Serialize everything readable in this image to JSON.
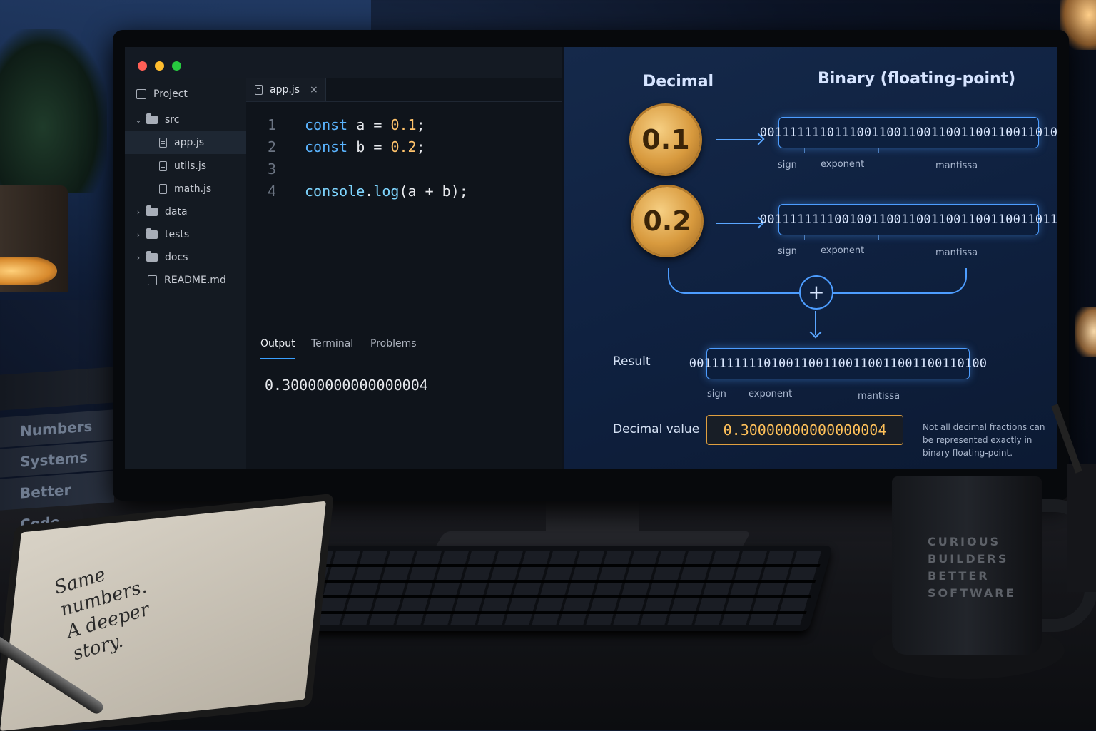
{
  "editor": {
    "sidebar": {
      "project_label": "Project",
      "items": [
        {
          "label": "src",
          "type": "folder",
          "expanded": true
        },
        {
          "label": "app.js",
          "type": "file",
          "active": true
        },
        {
          "label": "utils.js",
          "type": "file"
        },
        {
          "label": "math.js",
          "type": "file"
        },
        {
          "label": "data",
          "type": "folder"
        },
        {
          "label": "tests",
          "type": "folder"
        },
        {
          "label": "docs",
          "type": "folder"
        },
        {
          "label": "README.md",
          "type": "file"
        }
      ]
    },
    "tab": {
      "label": "app.js",
      "close": "×"
    },
    "code": {
      "line_numbers": [
        "1",
        "2",
        "3",
        "4"
      ],
      "lines": [
        {
          "kw": "const",
          "name": " a = ",
          "num": "0.1",
          "end": ";"
        },
        {
          "kw": "const",
          "name": " b = ",
          "num": "0.2",
          "end": ";"
        },
        {
          "text": ""
        },
        {
          "fn_obj": "console",
          "dot": ".",
          "fn": "log",
          "rest": "(a + b);"
        }
      ]
    },
    "panel": {
      "tabs": [
        "Output",
        "Terminal",
        "Problems"
      ],
      "active_tab": "Output",
      "output": "0.30000000000000004"
    }
  },
  "diagram": {
    "headers": {
      "decimal": "Decimal",
      "binary": "Binary (floating-point)"
    },
    "coins": [
      "0.1",
      "0.2"
    ],
    "binaries": [
      "0011111110111001100110011001100110011010",
      "0011111111001001100110011001100110011011"
    ],
    "bit_labels": {
      "sign": "sign",
      "exponent": "exponent",
      "mantissa": "mantissa"
    },
    "plus": "+",
    "result_label": "Result",
    "result_binary": "0011111111010011001100110011001100110100",
    "decimal_value_label": "Decimal value",
    "decimal_value": "0.30000000000000004",
    "note": "Not all decimal fractions can be represented exactly in binary floating-point."
  },
  "props": {
    "books": [
      "Numbers",
      "Systems",
      "Better Code"
    ],
    "notebook_lines": [
      "Same",
      "numbers.",
      "A deeper",
      "story."
    ],
    "mug_lines": [
      "CURIOUS",
      "BUILDERS",
      "BETTER",
      "SOFTWARE"
    ]
  },
  "colors": {
    "keyword": "#5ab4ff",
    "number": "#ffc36b",
    "accent_blue": "#4d9dff",
    "accent_gold": "#ffc15a"
  }
}
